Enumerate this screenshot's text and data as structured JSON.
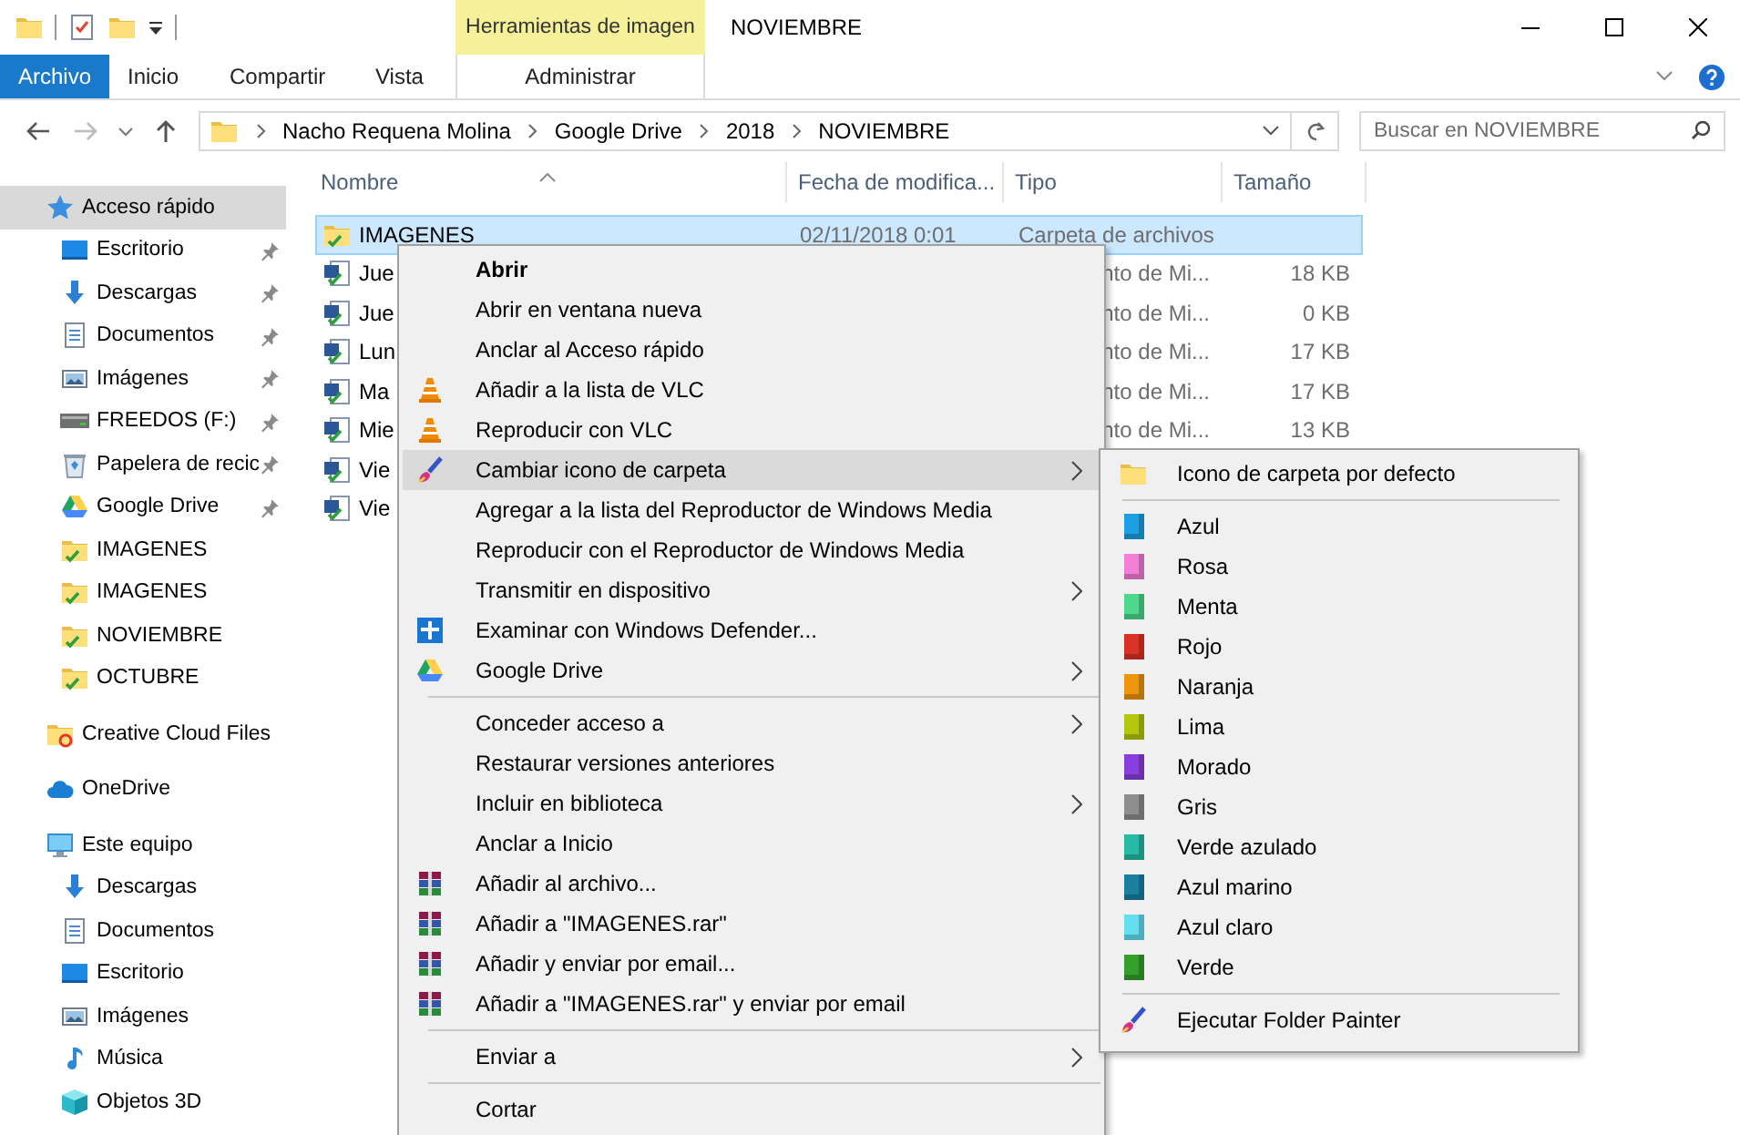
{
  "window": {
    "title": "NOVIEMBRE"
  },
  "ribbon": {
    "file_tab": "Archivo",
    "tabs": [
      "Inicio",
      "Compartir",
      "Vista"
    ],
    "contextual_group": {
      "title": "Herramientas de imagen",
      "tabs": [
        "Administrar"
      ]
    }
  },
  "address_bar": {
    "path": [
      "Nacho Requena Molina",
      "Google Drive",
      "2018",
      "NOVIEMBRE"
    ]
  },
  "search": {
    "placeholder": "Buscar en NOVIEMBRE"
  },
  "navigation": [
    {
      "label": "Acceso rápido",
      "kind": "star",
      "selected": true,
      "children": [
        {
          "label": "Escritorio",
          "kind": "desktop",
          "pinned": true
        },
        {
          "label": "Descargas",
          "kind": "download",
          "pinned": true
        },
        {
          "label": "Documentos",
          "kind": "document",
          "pinned": true
        },
        {
          "label": "Imágenes",
          "kind": "pictures",
          "pinned": true
        },
        {
          "label": "FREEDOS (F:)",
          "kind": "drive",
          "pinned": true
        },
        {
          "label": "Papelera de recic",
          "kind": "recycle",
          "pinned": true
        },
        {
          "label": "Google Drive",
          "kind": "drive-triangle",
          "pinned": true
        },
        {
          "label": "IMAGENES",
          "kind": "folder-check",
          "pinned": false
        },
        {
          "label": "IMAGENES",
          "kind": "folder-check",
          "pinned": false
        },
        {
          "label": "NOVIEMBRE",
          "kind": "folder-check",
          "pinned": false
        },
        {
          "label": "OCTUBRE",
          "kind": "folder-check",
          "pinned": false
        }
      ]
    },
    {
      "label": "Creative Cloud Files",
      "kind": "cc-folder",
      "selected": false
    },
    {
      "label": "OneDrive",
      "kind": "cloud",
      "selected": false
    },
    {
      "label": "Este equipo",
      "kind": "computer",
      "selected": false,
      "children": [
        {
          "label": "Descargas",
          "kind": "download",
          "pinned": false
        },
        {
          "label": "Documentos",
          "kind": "document",
          "pinned": false
        },
        {
          "label": "Escritorio",
          "kind": "desktop",
          "pinned": false
        },
        {
          "label": "Imágenes",
          "kind": "pictures",
          "pinned": false
        },
        {
          "label": "Música",
          "kind": "music",
          "pinned": false
        },
        {
          "label": "Objetos 3D",
          "kind": "cube",
          "pinned": false
        }
      ]
    }
  ],
  "file_list": {
    "columns": [
      "Nombre",
      "Fecha de modifica...",
      "Tipo",
      "Tamaño"
    ],
    "rows": [
      {
        "name": "IMAGENES",
        "kind": "folder-check",
        "selected": true,
        "date": "02/11/2018 0:01",
        "type": "Carpeta de archivos"
      },
      {
        "name": "Jue",
        "kind": "doc-check",
        "selected": false,
        "type": "nto de Mi...",
        "size": "18 KB"
      },
      {
        "name": "Jue",
        "kind": "doc-check",
        "selected": false,
        "type": "nto de Mi...",
        "size": "0 KB"
      },
      {
        "name": "Lun",
        "kind": "doc-check",
        "selected": false,
        "type": "nto de Mi...",
        "size": "17 KB"
      },
      {
        "name": "Ma",
        "kind": "doc-check",
        "selected": false,
        "type": "nto de Mi...",
        "size": "17 KB"
      },
      {
        "name": "Mie",
        "kind": "doc-check",
        "selected": false,
        "type": "nto de Mi...",
        "size": "13 KB"
      },
      {
        "name": "Vie",
        "kind": "doc-check",
        "selected": false
      },
      {
        "name": "Vie",
        "kind": "doc-check",
        "selected": false
      }
    ]
  },
  "context_menu": {
    "items": [
      {
        "kind": "plain",
        "label": "Abrir",
        "default": true,
        "submenu": false,
        "selected": false
      },
      {
        "kind": "plain",
        "label": "Abrir en ventana nueva",
        "default": false,
        "submenu": false,
        "selected": false
      },
      {
        "kind": "plain",
        "label": "Anclar al Acceso rápido",
        "default": false,
        "submenu": false,
        "selected": false
      },
      {
        "kind": "vlc",
        "label": "Añadir a la lista de VLC",
        "default": false,
        "submenu": false,
        "selected": false
      },
      {
        "kind": "vlc",
        "label": "Reproducir con VLC",
        "default": false,
        "submenu": false,
        "selected": false
      },
      {
        "kind": "painter",
        "label": "Cambiar icono de carpeta",
        "default": false,
        "submenu": true,
        "selected": true
      },
      {
        "kind": "plain",
        "label": "Agregar a la lista del Reproductor de Windows Media",
        "default": false,
        "submenu": false,
        "selected": false
      },
      {
        "kind": "plain",
        "label": "Reproducir con el Reproductor de Windows Media",
        "default": false,
        "submenu": false,
        "selected": false
      },
      {
        "kind": "plain",
        "label": "Transmitir en dispositivo",
        "default": false,
        "submenu": true,
        "selected": false
      },
      {
        "kind": "shield",
        "label": "Examinar con Windows Defender...",
        "default": false,
        "submenu": false,
        "selected": false
      },
      {
        "kind": "drive-triangle",
        "label": "Google Drive",
        "default": false,
        "submenu": true,
        "selected": false
      },
      {
        "kind": "separator"
      },
      {
        "kind": "plain",
        "label": "Conceder acceso a",
        "default": false,
        "submenu": true,
        "selected": false
      },
      {
        "kind": "plain",
        "label": "Restaurar versiones anteriores",
        "default": false,
        "submenu": false,
        "selected": false
      },
      {
        "kind": "plain",
        "label": "Incluir en biblioteca",
        "default": false,
        "submenu": true,
        "selected": false
      },
      {
        "kind": "plain",
        "label": "Anclar a Inicio",
        "default": false,
        "submenu": false,
        "selected": false
      },
      {
        "kind": "archive",
        "label": "Añadir al archivo...",
        "default": false,
        "submenu": false,
        "selected": false
      },
      {
        "kind": "archive",
        "label": "Añadir a \"IMAGENES.rar\"",
        "default": false,
        "submenu": false,
        "selected": false
      },
      {
        "kind": "archive",
        "label": "Añadir y enviar por email...",
        "default": false,
        "submenu": false,
        "selected": false
      },
      {
        "kind": "archive",
        "label": "Añadir a \"IMAGENES.rar\" y enviar por email",
        "default": false,
        "submenu": false,
        "selected": false
      },
      {
        "kind": "separator"
      },
      {
        "kind": "plain",
        "label": "Enviar a",
        "default": false,
        "submenu": true,
        "selected": false
      },
      {
        "kind": "separator"
      },
      {
        "kind": "plain",
        "label": "Cortar",
        "default": false,
        "submenu": false,
        "selected": false
      }
    ]
  },
  "submenu": {
    "items": [
      {
        "kind": "folder",
        "label": "Icono de carpeta por defecto"
      },
      {
        "kind": "separator"
      },
      {
        "kind": "color",
        "label": "Azul",
        "color": "#1ba1e2"
      },
      {
        "kind": "color",
        "label": "Rosa",
        "color": "#f47fd8"
      },
      {
        "kind": "color",
        "label": "Menta",
        "color": "#4cd98e"
      },
      {
        "kind": "color",
        "label": "Rojo",
        "color": "#db3226"
      },
      {
        "kind": "color",
        "label": "Naranja",
        "color": "#ee960c"
      },
      {
        "kind": "color",
        "label": "Lima",
        "color": "#b4c70c"
      },
      {
        "kind": "color",
        "label": "Morado",
        "color": "#8a3fdc"
      },
      {
        "kind": "color",
        "label": "Gris",
        "color": "#8e8e8e"
      },
      {
        "kind": "color",
        "label": "Verde azulado",
        "color": "#26bba5"
      },
      {
        "kind": "color",
        "label": "Azul marino",
        "color": "#1a7fa0"
      },
      {
        "kind": "color",
        "label": "Azul claro",
        "color": "#62e0f0"
      },
      {
        "kind": "color",
        "label": "Verde",
        "color": "#34a02c"
      },
      {
        "kind": "separator"
      },
      {
        "kind": "painter",
        "label": "Ejecutar Folder Painter"
      }
    ]
  }
}
